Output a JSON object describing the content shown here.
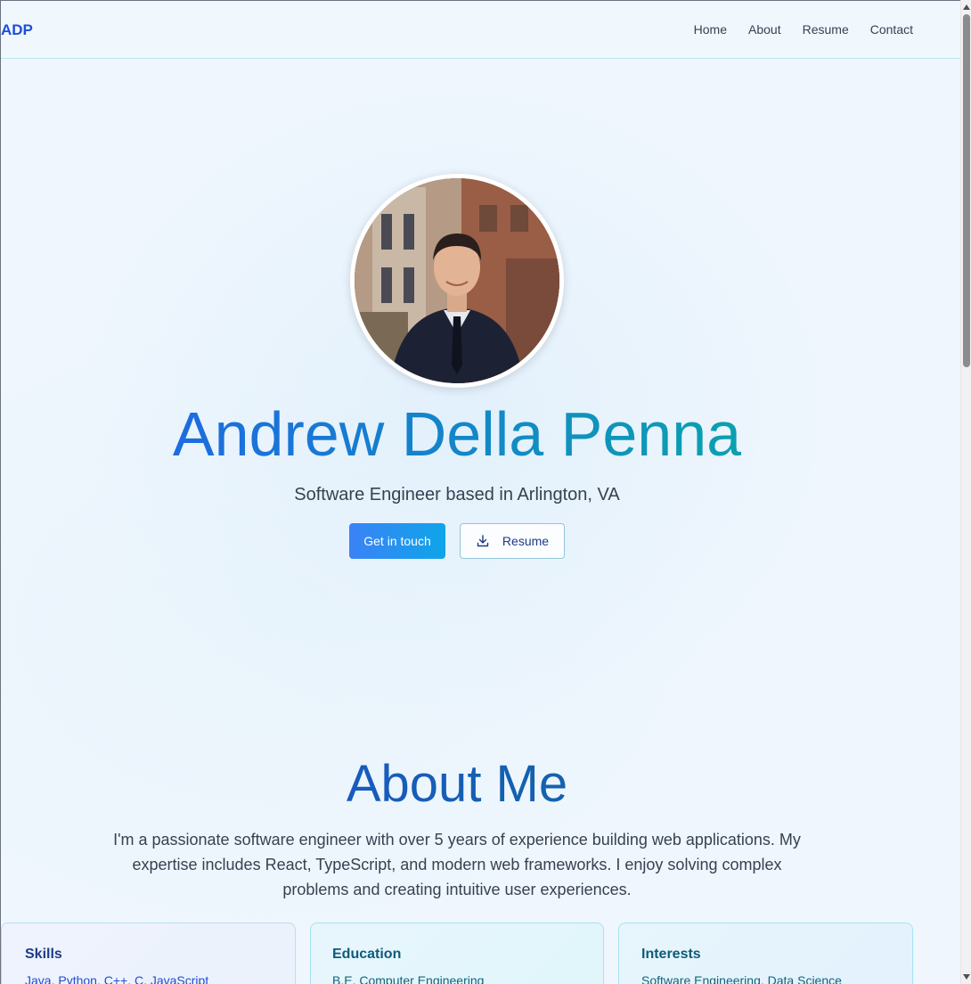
{
  "header": {
    "logo": "ADP",
    "nav": [
      "Home",
      "About",
      "Resume",
      "Contact"
    ]
  },
  "hero": {
    "name": "Andrew Della Penna",
    "subtitle": "Software Engineer based in Arlington, VA",
    "primary_button": "Get in touch",
    "secondary_button": "Resume",
    "secondary_icon": "download-icon"
  },
  "about": {
    "title": "About Me",
    "text": "I'm a passionate software engineer with over 5 years of experience building web applications. My expertise includes React, TypeScript, and modern web frameworks. I enjoy solving complex problems and creating intuitive user experiences.",
    "cards": [
      {
        "title": "Skills",
        "text": "Java, Python, C++, C, JavaScript"
      },
      {
        "title": "Education",
        "text": "B.E. Computer Engineering"
      },
      {
        "title": "Interests",
        "text": "Software Engineering, Data Science"
      }
    ]
  },
  "colors": {
    "accent": "#1d4ed8",
    "gradient_start": "#3b82f6",
    "gradient_end": "#0ea5e9",
    "background": "#eff6fd"
  }
}
